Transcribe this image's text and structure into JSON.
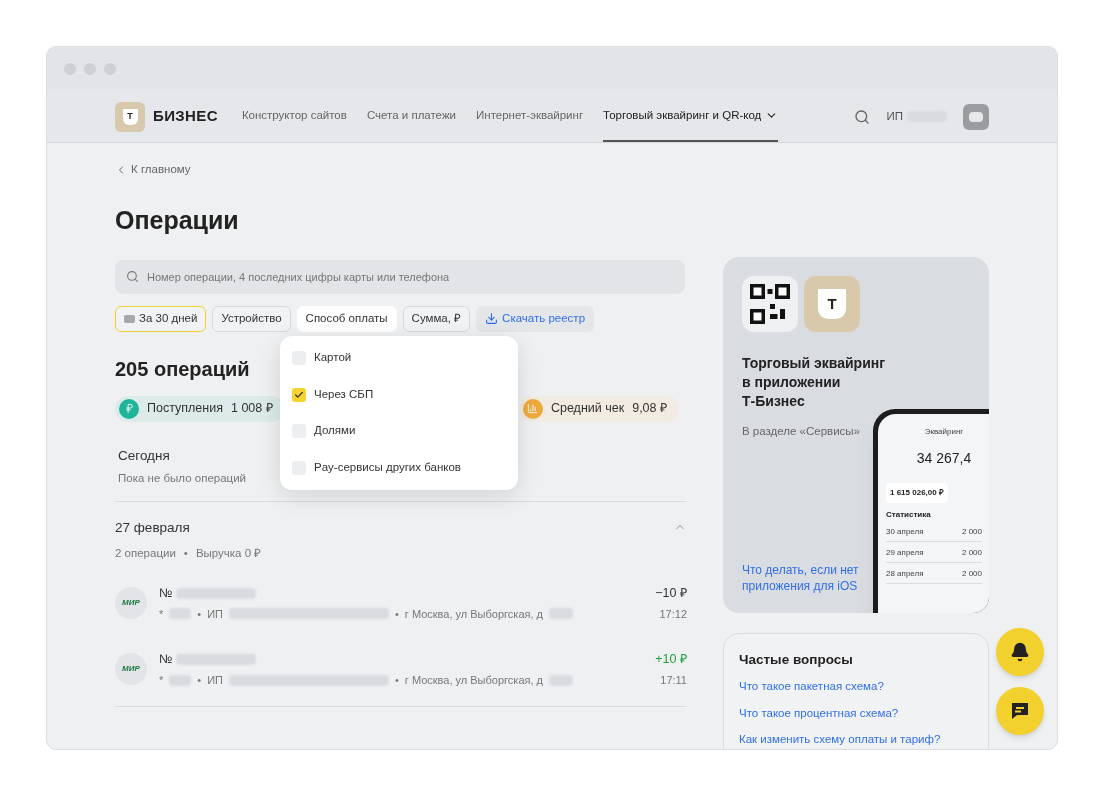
{
  "nav": {
    "logo_letter": "Т",
    "logo_text": "БИЗНЕС",
    "items": [
      {
        "label": "Конструктор сайтов",
        "selected": false,
        "caret": false
      },
      {
        "label": "Счета и платежи",
        "selected": false,
        "caret": false
      },
      {
        "label": "Интернет-эквайринг",
        "selected": false,
        "caret": false
      },
      {
        "label": "Торговый эквайринг и QR-код",
        "selected": true,
        "caret": true
      }
    ],
    "account": "ИП"
  },
  "back_link": "К главному",
  "title": "Операции",
  "search": {
    "placeholder": "Номер операции, 4 последних цифры карты или телефона"
  },
  "filters": [
    {
      "label": "За 30 дней",
      "kind": "period",
      "selected": true
    },
    {
      "label": "Устройство",
      "kind": "plain",
      "selected": false
    },
    {
      "label": "Способ оплаты",
      "kind": "plain",
      "selected": false,
      "open": true
    },
    {
      "label": "Сумма, ₽",
      "kind": "plain",
      "selected": false
    },
    {
      "label": "Скачать реестр",
      "kind": "download",
      "selected": false
    }
  ],
  "dropdown": [
    {
      "label": "Картой",
      "checked": false
    },
    {
      "label": "Через СБП",
      "checked": true
    },
    {
      "label": "Долями",
      "checked": false
    },
    {
      "label": "Pay-сервисы других банков",
      "checked": false
    }
  ],
  "summary": "205 операций",
  "stats": [
    {
      "label": "Поступления",
      "value": "1 008 ₽",
      "kind": "income",
      "color": "#1fb59a"
    },
    {
      "label": "Средний чек",
      "value": "9,08 ₽",
      "kind": "average",
      "color": "#f0a93c"
    }
  ],
  "today": {
    "heading": "Сегодня",
    "note": "Пока не было операций"
  },
  "groups": [
    {
      "date": "27 февраля",
      "count": "2 операции",
      "separator": "•",
      "revenue": "Выручка 0 ₽",
      "expanded": true,
      "operations": [
        {
          "number_prefix": "№",
          "card_prefix": "*",
          "separator": "•",
          "merchant_prefix": "ИП",
          "address": "г Москва, ул Выборгская, д",
          "amount": "−10 ₽",
          "kind": "debit",
          "time": "17:12",
          "brand": "МИР"
        },
        {
          "number_prefix": "№",
          "card_prefix": "*",
          "separator": "•",
          "merchant_prefix": "ИП",
          "address": "г Москва, ул Выборгская, д",
          "amount": "+10 ₽",
          "kind": "credit",
          "time": "17:11",
          "brand": "МИР"
        }
      ]
    }
  ],
  "promo": {
    "app_letter": "Т",
    "title_lines": [
      "Торговый эквайринг",
      "в приложении",
      "Т-Бизнес"
    ],
    "subtitle": "В разделе «Сервисы»",
    "link": "Что делать, если нет приложения для iOS",
    "phone": {
      "title": "Эквайринг",
      "total": "34 267,4",
      "card_value": "1 615 026,00 ₽",
      "section": "Статистика",
      "rows": [
        {
          "date": "30 апреля",
          "value": "2 000"
        },
        {
          "date": "29 апреля",
          "value": "2 000"
        },
        {
          "date": "28 апреля",
          "value": "2 000"
        }
      ]
    }
  },
  "faq": {
    "title": "Частые вопросы",
    "links": [
      "Что такое пакетная схема?",
      "Что такое процентная схема?",
      "Как изменить схему оплаты и тариф?"
    ]
  }
}
